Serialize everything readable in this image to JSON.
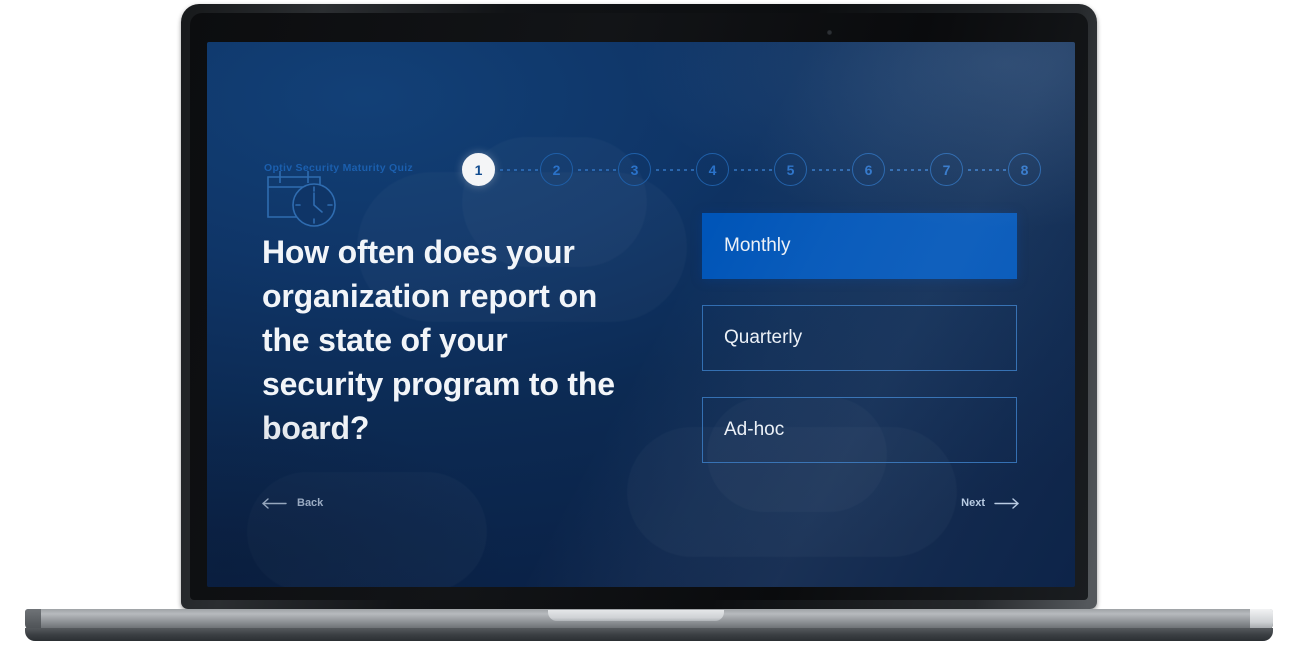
{
  "brand": {
    "quiz_title": "Optiv Security Maturity Quiz"
  },
  "stepper": {
    "current_step": 1,
    "total_steps": 8,
    "steps": [
      {
        "label": "1",
        "active": true
      },
      {
        "label": "2",
        "active": false
      },
      {
        "label": "3",
        "active": false
      },
      {
        "label": "4",
        "active": false
      },
      {
        "label": "5",
        "active": false
      },
      {
        "label": "6",
        "active": false
      },
      {
        "label": "7",
        "active": false
      },
      {
        "label": "8",
        "active": false
      }
    ]
  },
  "question": {
    "icon": "calendar-clock-icon",
    "text": "How often does your organization report on the state of your security program to the board?"
  },
  "options": [
    {
      "label": "Monthly",
      "selected": true
    },
    {
      "label": "Quarterly",
      "selected": false
    },
    {
      "label": "Ad-hoc",
      "selected": false
    }
  ],
  "nav": {
    "back_label": "Back",
    "next_label": "Next",
    "back_icon": "arrow-left-icon",
    "next_icon": "arrow-right-icon"
  },
  "colors": {
    "accent_selected": "#0055b8",
    "screen_bg_top": "#124077",
    "screen_bg_bottom": "#0a2146",
    "brand_text": "#1b5fae",
    "option_border": "#2f6cb0",
    "step_active_bg": "#f4f5f7",
    "step_active_text": "#114b8f"
  }
}
